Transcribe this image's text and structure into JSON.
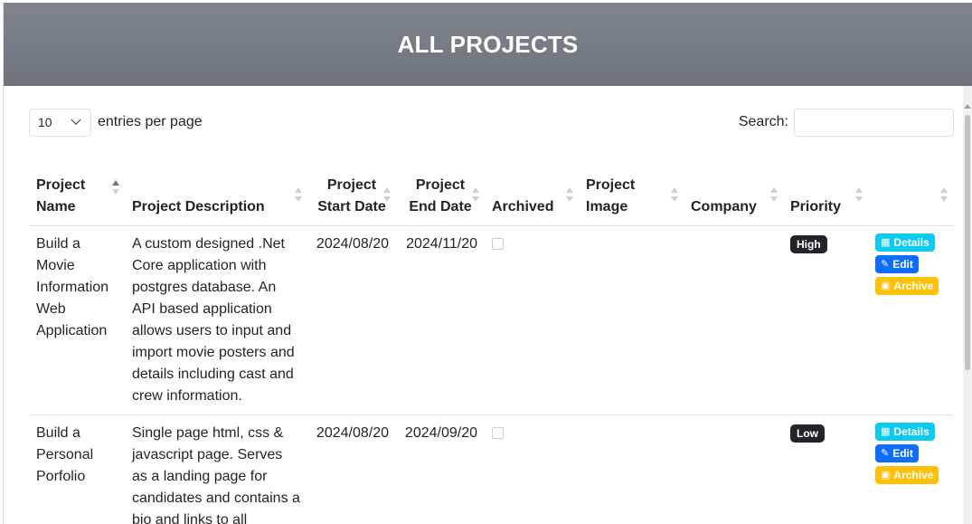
{
  "page": {
    "title": "ALL PROJECTS"
  },
  "controls": {
    "entries_value": "10",
    "entries_label": "entries per page",
    "search_label": "Search:",
    "search_value": ""
  },
  "table": {
    "headers": {
      "name": "Project Name",
      "description": "Project Description",
      "start": "Project Start Date",
      "end": "Project End Date",
      "archived": "Archived",
      "image": "Project Image",
      "company": "Company",
      "priority": "Priority",
      "actions": ""
    },
    "rows": [
      {
        "name": "Build a Movie Information Web Application",
        "description": "A custom designed .Net Core application with postgres database. An API based application allows users to input and import movie posters and details including cast and crew information.",
        "start": "2024/08/20",
        "end": "2024/11/20",
        "archived": false,
        "image": "",
        "company": "",
        "priority": "High",
        "details": "Details",
        "edit": "Edit",
        "archive": "Archive"
      },
      {
        "name": "Build a Personal Porfolio",
        "description": "Single page html, css & javascript page. Serves as a landing page for candidates and contains a bio and links to all",
        "start": "2024/08/20",
        "end": "2024/09/20",
        "archived": false,
        "image": "",
        "company": "",
        "priority": "Low",
        "details": "Details",
        "edit": "Edit",
        "archive": "Archive"
      }
    ]
  },
  "colors": {
    "details": "#0dcaf0",
    "edit": "#0d6efd",
    "archive": "#ffc107",
    "badge": "#212529"
  },
  "icons": {
    "details": "building-icon",
    "edit": "pencil-square-icon",
    "archive": "archive-box-icon"
  }
}
